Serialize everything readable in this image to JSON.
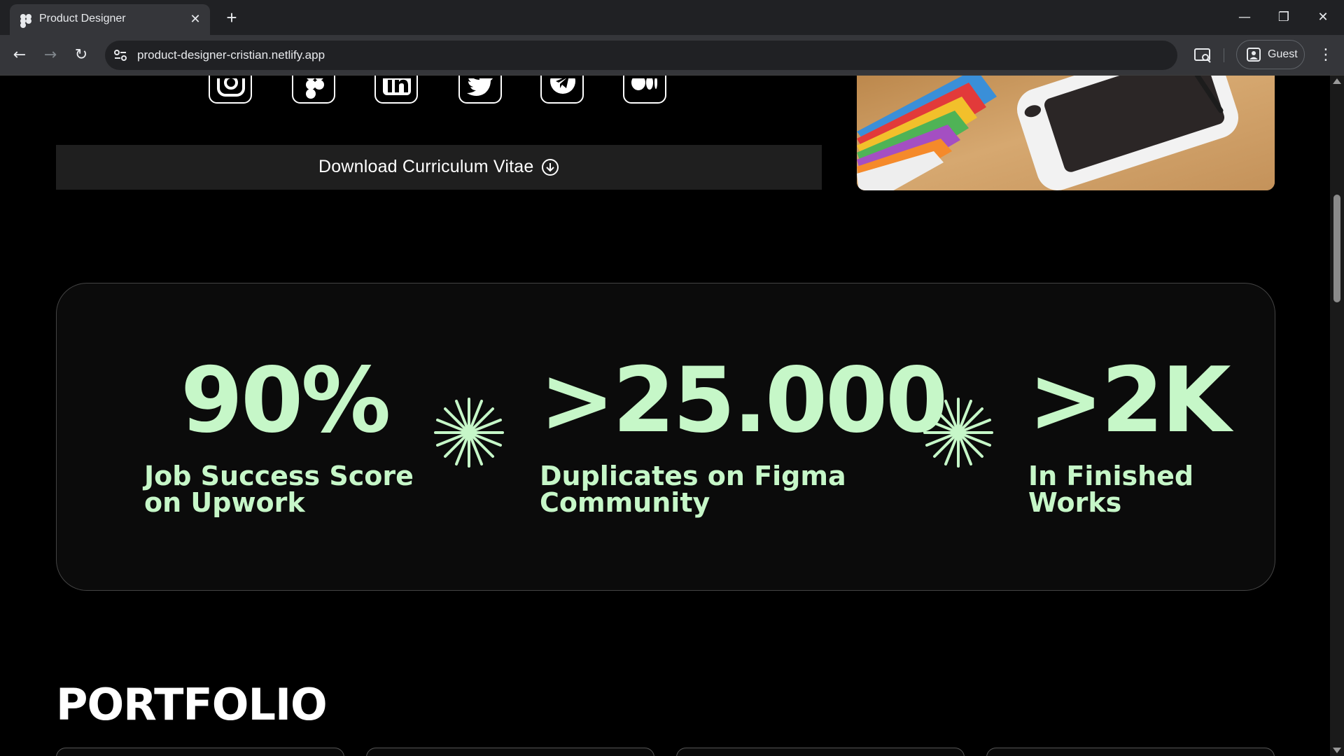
{
  "browser": {
    "tab_title": "Product Designer",
    "url": "product-designer-cristian.netlify.app",
    "profile_label": "Guest"
  },
  "icons": {
    "social": [
      "instagram-icon",
      "figma-icon",
      "linkedin-icon",
      "twitter-icon",
      "telegram-icon",
      "medium-icon"
    ]
  },
  "hero": {
    "cv_button_label": "Download Curriculum Vitae"
  },
  "stats": [
    {
      "value": "90%",
      "label_line1": "Job Success Score",
      "label_line2": "on Upwork"
    },
    {
      "value": ">25.000",
      "label_line1": "Duplicates on Figma",
      "label_line2": "Community"
    },
    {
      "value": ">2K",
      "label_line1": "In Finished",
      "label_line2": "Works"
    }
  ],
  "portfolio": {
    "title": "PORTFOLIO"
  },
  "colors": {
    "accent": "#c6f7c8",
    "background": "#000000",
    "card": "#0b0b0b"
  }
}
